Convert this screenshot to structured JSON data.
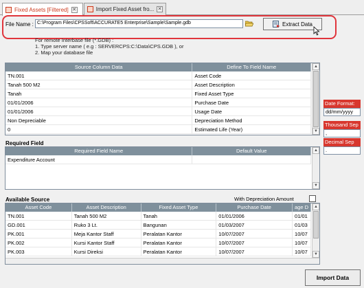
{
  "tabs": [
    {
      "label": "Fixed Assets [Filtered]"
    },
    {
      "label": "Import Fixed Asset fro..."
    }
  ],
  "file": {
    "label": "File Name :",
    "path": "C:\\Program Files\\CPSSoft\\ACCURATE5 Enterprise\\Sample\\Sample.gdb",
    "extract_label": "Extract Data"
  },
  "hints": [
    "For remote Interbase file (*.GDB) :",
    "1. Type server name ( e.g : SERVERCPS:C:\\Data\\CPS.GDB ), or",
    "2. Map your database file"
  ],
  "mapping": {
    "headers": [
      "Source Column Data",
      "Define To Field Name"
    ],
    "rows": [
      [
        "TN.001",
        "Asset Code"
      ],
      [
        "Tanah 500 M2",
        "Asset Description"
      ],
      [
        "Tanah",
        "Fixed Asset Type"
      ],
      [
        "01/01/2006",
        "Purchase Date"
      ],
      [
        "01/01/2006",
        "Usage Date"
      ],
      [
        "Non Depreciable",
        "Depreciation Method"
      ],
      [
        "0",
        "Estimated Life (Year)"
      ]
    ]
  },
  "required": {
    "title": "Required Field",
    "headers": [
      "Required Field Name",
      "Default Value"
    ],
    "rows": [
      [
        "Expenditure Account",
        ""
      ]
    ]
  },
  "available": {
    "title": "Available Source",
    "with_depr_label": "With Depreciation Amount",
    "headers": [
      "Asset Code",
      "Asset Description",
      "Fixed Asset Type",
      "Purchase Date",
      "age D"
    ],
    "rows": [
      [
        "TN.001",
        "Tanah 500 M2",
        "Tanah",
        "01/01/2006",
        "01/01"
      ],
      [
        "GD.001",
        "Ruko 3 Lt.",
        "Bangunan",
        "01/03/2007",
        "01/03"
      ],
      [
        "PK.001",
        "Meja Kantor Staff",
        "Peralatan Kantor",
        "10/07/2007",
        "10/07"
      ],
      [
        "PK.002",
        "Kursi Kantor Staff",
        "Peralatan Kantor",
        "10/07/2007",
        "10/07"
      ],
      [
        "PK.003",
        "Kursi Direksi",
        "Peralatan Kantor",
        "10/07/2007",
        "10/07"
      ]
    ]
  },
  "side": {
    "date_format_label": "Date Format:",
    "date_format_value": "dd/mm/yyyy",
    "thousand_sep_label": "Thousand Sep",
    "thousand_sep_value": ",",
    "decimal_sep_label": "Decimal Sep",
    "decimal_sep_value": "."
  },
  "import_label": "Import Data",
  "colors": {
    "accent_red": "#d8372e",
    "grid_header": "#7f909c",
    "highlight": "#e0343b"
  }
}
